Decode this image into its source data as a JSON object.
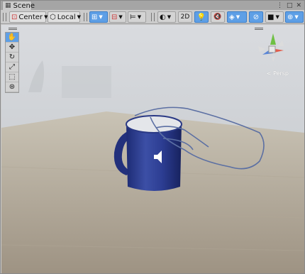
{
  "tab": {
    "label": "Scene",
    "icon": "scene-grid-icon"
  },
  "toolbar": {
    "pivot_label": "Center",
    "space_label": "Local",
    "mode_2d_label": "2D"
  },
  "gizmo": {
    "projection_label": "< Persp"
  },
  "colors": {
    "accent": "#5e9fe6",
    "mug": "#2e3f8e",
    "hand_outline": "#5b6fa3"
  }
}
